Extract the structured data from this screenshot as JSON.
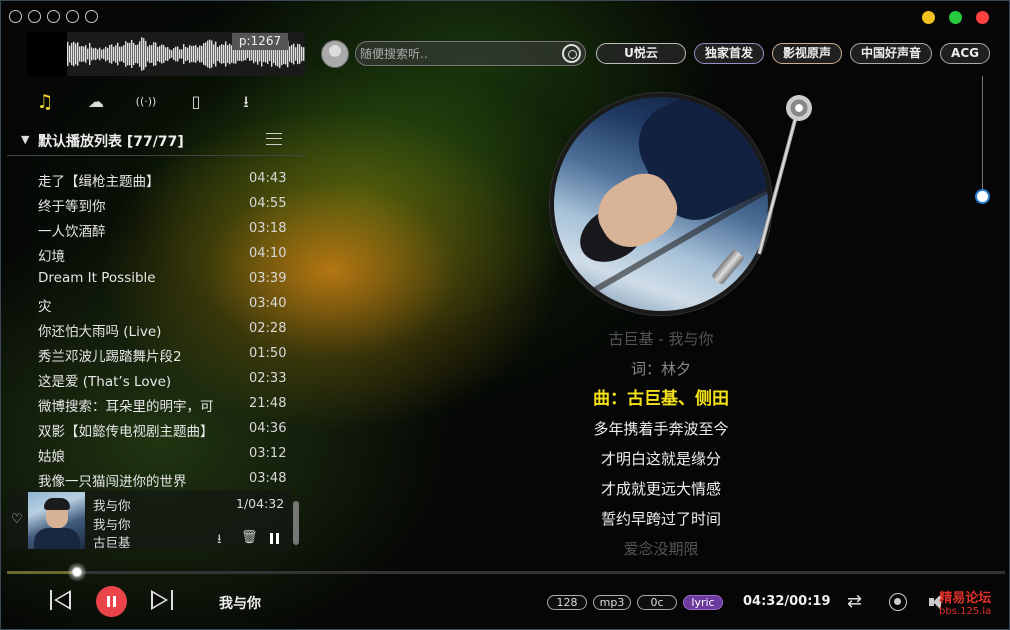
{
  "colors": {
    "accent_yellow": "#f5e21a",
    "play_button_red": "#e8444a",
    "lyric_pill_purple": "#6b3a9c",
    "traffic_yellow": "#f4c020",
    "traffic_green": "#27c93f",
    "traffic_red": "#ff4040"
  },
  "waveform": {
    "position_label": "p:1267"
  },
  "search": {
    "placeholder": "随便搜索听.."
  },
  "tags": [
    "U悦云",
    "独家首发",
    "影视原声",
    "中国好声音",
    "ACG"
  ],
  "sidebar": {
    "tabs": [
      {
        "name": "music-note-icon",
        "glyph": "♫",
        "active": true
      },
      {
        "name": "cloud-icon",
        "glyph": "☁",
        "active": false
      },
      {
        "name": "radio-icon",
        "glyph": "((·))",
        "active": false
      },
      {
        "name": "device-icon",
        "glyph": "▯",
        "active": false
      },
      {
        "name": "download-icon",
        "glyph": "⭳",
        "active": false
      }
    ],
    "playlist_title": "默认播放列表  [77/77]",
    "songs": [
      {
        "title": "走了【缉枪主题曲】",
        "duration": "04:43"
      },
      {
        "title": "终于等到你",
        "duration": "04:55"
      },
      {
        "title": "一人饮酒醉",
        "duration": "03:18"
      },
      {
        "title": "幻境",
        "duration": "04:10"
      },
      {
        "title": "Dream It Possible",
        "duration": "03:39"
      },
      {
        "title": "灾",
        "duration": "03:40"
      },
      {
        "title": "你还怕大雨吗 (Live)",
        "duration": "02:28"
      },
      {
        "title": "秀兰邓波儿踢踏舞片段2",
        "duration": "01:50"
      },
      {
        "title": "这是爱 (That’s Love)",
        "duration": "02:33"
      },
      {
        "title": "微博搜索：耳朵里的明宇，可",
        "duration": "21:48"
      },
      {
        "title": "双影【如懿传电视剧主题曲】",
        "duration": "04:36"
      },
      {
        "title": "姑娘",
        "duration": "03:12"
      },
      {
        "title": "我像一只猫闯进你的世界",
        "duration": "03:48"
      }
    ]
  },
  "now_playing": {
    "title": "我与你",
    "album": "我与你",
    "artist": "古巨基",
    "position_text": "1/04:32"
  },
  "lyrics": [
    {
      "text": "古巨基 - 我与你",
      "state": "dim"
    },
    {
      "text": "词：林夕",
      "state": "half"
    },
    {
      "text": "曲：古巨基、侧田",
      "state": "current"
    },
    {
      "text": "多年携着手奔波至今",
      "state": "normal"
    },
    {
      "text": "才明白这就是缘分",
      "state": "normal"
    },
    {
      "text": "才成就更远大情感",
      "state": "normal"
    },
    {
      "text": "誓约早跨过了时间",
      "state": "normal"
    },
    {
      "text": "爱念没期限",
      "state": "dim"
    }
  ],
  "player": {
    "song_title": "我与你",
    "progress": 0.07,
    "bitrate": "128",
    "format": "mp3",
    "channel": "0c",
    "lyric_label": "lyric",
    "time": "04:32/00:19"
  },
  "watermark": {
    "line1": "精易论坛",
    "line2": "bbs.125.la"
  }
}
